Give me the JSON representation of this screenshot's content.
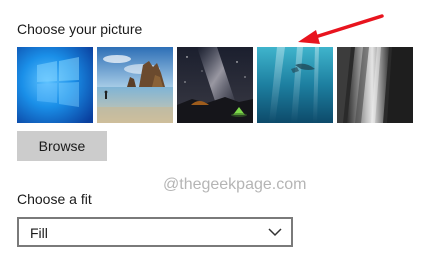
{
  "background": {
    "heading": "Choose your picture",
    "thumbnails": [
      {
        "name": "windows-logo-wallpaper",
        "selected": false
      },
      {
        "name": "beach-rocks-wallpaper",
        "selected": false
      },
      {
        "name": "milky-way-tent-wallpaper",
        "selected": false
      },
      {
        "name": "underwater-swimmer-wallpaper",
        "selected": false
      },
      {
        "name": "rock-cliff-wallpaper",
        "selected": false
      }
    ],
    "browse_label": "Browse"
  },
  "watermark": "@thegeekpage.com",
  "fit": {
    "heading": "Choose a fit",
    "selected": "Fill"
  },
  "annotation": {
    "arrow_color": "#e8141e"
  }
}
